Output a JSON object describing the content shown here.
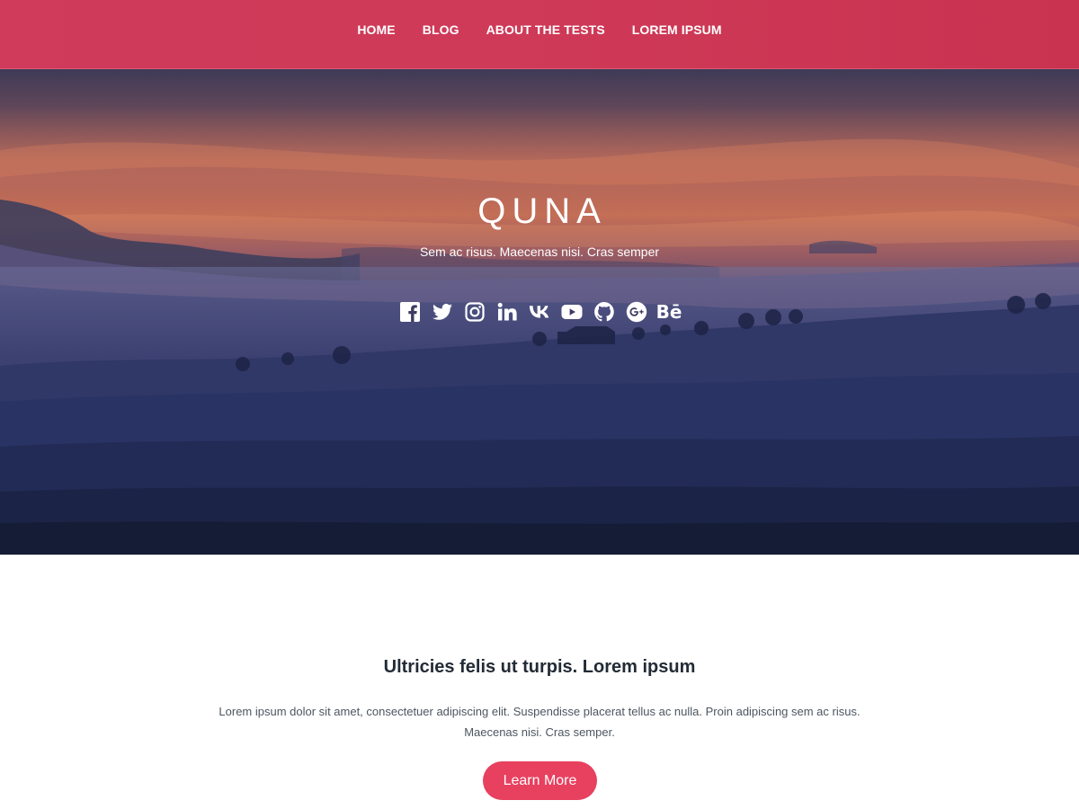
{
  "nav": {
    "items": [
      {
        "label": "HOME"
      },
      {
        "label": "BLOG"
      },
      {
        "label": "ABOUT THE TESTS"
      },
      {
        "label": "LOREM IPSUM"
      }
    ]
  },
  "hero": {
    "title": "QUNA",
    "tagline": "Sem ac risus. Maecenas nisi. Cras semper",
    "socials": [
      {
        "icon": "facebook-icon"
      },
      {
        "icon": "twitter-icon"
      },
      {
        "icon": "instagram-icon"
      },
      {
        "icon": "linkedin-icon"
      },
      {
        "icon": "vk-icon"
      },
      {
        "icon": "youtube-icon"
      },
      {
        "icon": "github-icon"
      },
      {
        "icon": "google-plus-icon"
      },
      {
        "icon": "behance-icon",
        "glyph": "Bē"
      }
    ]
  },
  "feature": {
    "heading": "Ultricies felis ut turpis. Lorem ipsum",
    "body": "Lorem ipsum dolor sit amet, consectetuer adipiscing elit. Suspendisse placerat tellus ac nulla. Proin adipiscing sem ac risus. Maecenas nisi. Cras semper.",
    "button_label": "Learn More"
  },
  "colors": {
    "nav_bg": "#cd3857",
    "accent": "#e8405f",
    "heading": "#222b36",
    "body_text": "#4d5661"
  }
}
